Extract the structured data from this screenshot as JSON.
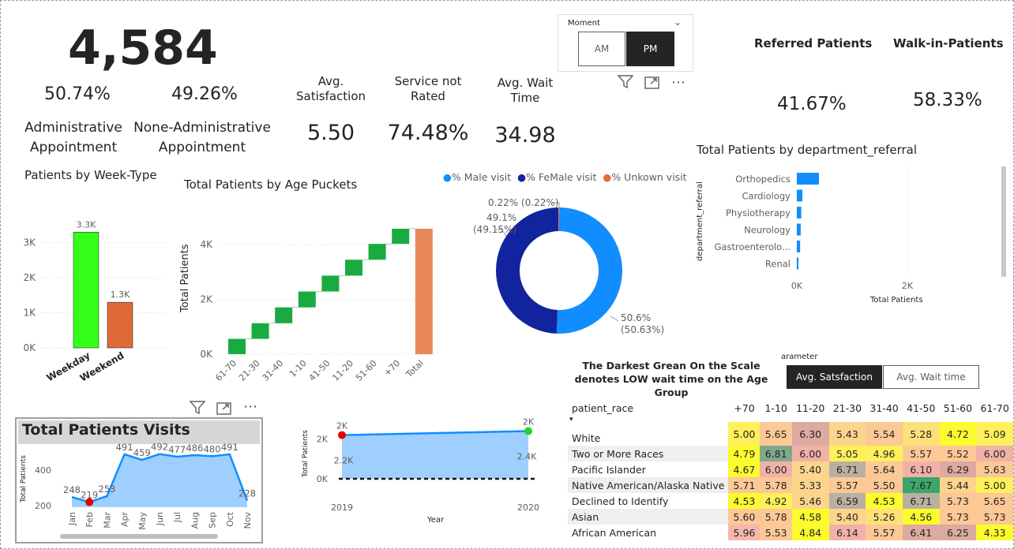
{
  "kpis": {
    "total": "4,584",
    "admin_pct": "50.74%",
    "nonadmin_pct": "49.26%",
    "admin_label_1": "Administrative",
    "admin_label_2": "Appointment",
    "nonadmin_label_1": "None-Administrative",
    "nonadmin_label_2": "Appointment",
    "avg_sat_label_1": "Avg.",
    "avg_sat_label_2": "Satisfaction",
    "avg_sat_value": "5.50",
    "not_rated_label_1": "Service not",
    "not_rated_label_2": "Rated",
    "not_rated_value": "74.48%",
    "wait_label_1": "Avg. Wait",
    "wait_label_2": "Time",
    "wait_value": "34.98",
    "referred_label": "Referred Patients",
    "walkin_label": "Walk-in-Patients",
    "referred_value": "41.67%",
    "walkin_value": "58.33%"
  },
  "slicer": {
    "title": "Moment",
    "options": [
      "AM",
      "PM"
    ],
    "selected": "PM"
  },
  "icons": [
    "filter-icon",
    "focus-mode-icon",
    "more-options-icon",
    "chevron-down-icon"
  ],
  "week_chart": {
    "title": "Patients by Week-Type",
    "colors": {
      "Weekday": "#33ff19",
      "Weekend": "#e0693a"
    }
  },
  "age_chart": {
    "title": "Total Patients by Age Puckets",
    "ylabel": "Total Patients",
    "colors": {
      "increase": "#1aab40",
      "total": "#e8895c"
    }
  },
  "donut": {
    "legend": [
      "% Male visit",
      "% FeMale visit",
      "% Unkown visit"
    ],
    "colors": [
      "#118dff",
      "#12239e",
      "#e66c37"
    ],
    "label_male_1": "50.6%",
    "label_male_2": "(50.63%)",
    "label_female_1": "49.1%",
    "label_female_2": "(49.15%)",
    "label_unknown": "0.22% (0.22%)"
  },
  "dept_chart": {
    "title": "Total Patients by department_referral",
    "ylabel": "department_referral",
    "xlabel": "Total Patients",
    "color": "#118dff"
  },
  "visits_chart": {
    "title": "Total Patients Visits",
    "ylabel": "Total Patients",
    "y_ticks": [
      "400",
      "200"
    ]
  },
  "year_chart": {
    "ylabel": "Total Patients",
    "xlabel": "Year",
    "y_ticks": [
      "2K",
      "0K"
    ],
    "label_2019_top": "2K",
    "label_2019_mid": "2.2K",
    "label_2020_top": "2K",
    "label_2020_mid": "2.4K"
  },
  "matrix": {
    "note_line1": "The Darkest Grean On the Scale",
    "note_line2": "denotes LOW wait time on the Age Group",
    "param_label": "arameter",
    "param_options": [
      "Avg. Satsfaction",
      "Avg. Wait time"
    ],
    "param_selected": "Avg. Satsfaction",
    "row_header": "patient_race",
    "columns": [
      "+70",
      "1-10",
      "11-20",
      "21-30",
      "31-40",
      "41-50",
      "51-60",
      "61-70"
    ],
    "rows": [
      {
        "race": "White",
        "values": [
          "5.00",
          "5.65",
          "6.30",
          "5.43",
          "5.54",
          "5.28",
          "4.72",
          "5.09"
        ]
      },
      {
        "race": "Two or More Races",
        "values": [
          "4.79",
          "6.81",
          "6.00",
          "5.05",
          "4.96",
          "5.57",
          "5.52",
          "6.00"
        ]
      },
      {
        "race": "Pacific Islander",
        "values": [
          "4.67",
          "6.00",
          "5.40",
          "6.71",
          "5.64",
          "6.10",
          "6.29",
          "5.63"
        ]
      },
      {
        "race": "Native American/Alaska Native",
        "values": [
          "5.71",
          "5.78",
          "5.33",
          "5.57",
          "5.50",
          "7.67",
          "5.44",
          "5.00"
        ]
      },
      {
        "race": "Declined to Identify",
        "values": [
          "4.53",
          "4.92",
          "5.46",
          "6.59",
          "4.53",
          "6.71",
          "5.73",
          "5.65"
        ]
      },
      {
        "race": "Asian",
        "values": [
          "5.60",
          "5.78",
          "4.58",
          "5.40",
          "5.26",
          "4.56",
          "5.73",
          "5.73"
        ]
      },
      {
        "race": "African American",
        "values": [
          "5.96",
          "5.53",
          "4.84",
          "6.14",
          "5.57",
          "6.41",
          "6.25",
          "4.33"
        ]
      }
    ]
  },
  "chart_data": [
    {
      "type": "bar",
      "title": "Patients by Week-Type",
      "categories": [
        "Weekday",
        "Weekend"
      ],
      "values": [
        3300,
        1300
      ],
      "data_labels": [
        "3.3K",
        "1.3K"
      ],
      "y_ticks": [
        "0K",
        "1K",
        "2K",
        "3K"
      ],
      "ylim": [
        0,
        3600
      ]
    },
    {
      "type": "bar",
      "subtype": "waterfall",
      "title": "Total Patients by Age Puckets",
      "ylabel": "Total Patients",
      "categories": [
        "61-70",
        "21-30",
        "31-40",
        "1-10",
        "41-50",
        "11-20",
        "51-60",
        "+70",
        "Total"
      ],
      "increments": [
        560,
        570,
        580,
        580,
        580,
        580,
        580,
        554
      ],
      "total": 4584,
      "y_ticks": [
        "0K",
        "2K",
        "4K"
      ],
      "ylim": [
        0,
        4900
      ]
    },
    {
      "type": "pie",
      "subtype": "donut",
      "labels": [
        "% Male visit",
        "% FeMale visit",
        "% Unkown visit"
      ],
      "values": [
        50.63,
        49.15,
        0.22
      ]
    },
    {
      "type": "bar",
      "orientation": "horizontal",
      "title": "Total Patients by department_referral",
      "ylabel": "department_referral",
      "xlabel": "Total Patients",
      "categories": [
        "Orthopedics",
        "Cardiology",
        "Physiotherapy",
        "Neurology",
        "Gastroenterolo...",
        "Renal"
      ],
      "values": [
        400,
        100,
        80,
        70,
        60,
        30
      ],
      "x_ticks": [
        "0K",
        "2K"
      ],
      "xlim": [
        0,
        2400
      ]
    },
    {
      "type": "area",
      "title": "Total Patients Visits",
      "ylabel": "Total Patients",
      "categories": [
        "Jan",
        "Feb",
        "Mar",
        "Apr",
        "May",
        "Jun",
        "Jul",
        "Aug",
        "Sep",
        "Oct",
        "Nov"
      ],
      "values": [
        248,
        219,
        253,
        491,
        459,
        492,
        477,
        486,
        480,
        491,
        228
      ],
      "data_labels": [
        "248",
        "219",
        "253",
        "491",
        "459",
        "492",
        "477",
        "486",
        "480",
        "491",
        "228"
      ],
      "y_ticks": [
        "200",
        "400"
      ],
      "ylim": [
        190,
        540
      ]
    },
    {
      "type": "area",
      "ylabel": "Total Patients",
      "xlabel": "Year",
      "categories": [
        "2019",
        "2020"
      ],
      "values": [
        2200,
        2400
      ],
      "y_ticks": [
        "0K",
        "2K"
      ],
      "ylim": [
        0,
        2700
      ]
    }
  ]
}
